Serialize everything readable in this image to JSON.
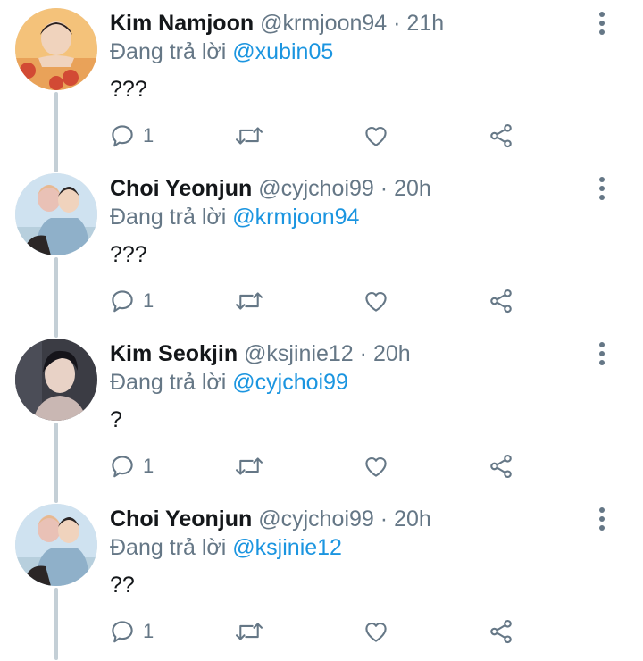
{
  "reply_prefix": "Đang trả lời",
  "tweets": [
    {
      "name": "Kim Namjoon",
      "handle": "@krmjoon94",
      "separator": "·",
      "time": "21h",
      "reply_to": "@xubin05",
      "text": "???",
      "reply_count": "1",
      "avatar_palette": [
        "#e9a259",
        "#d24a34",
        "#f4c27a",
        "#2a2120"
      ]
    },
    {
      "name": "Choi Yeonjun",
      "handle": "@cyjchoi99",
      "separator": "·",
      "time": "20h",
      "reply_to": "@krmjoon94",
      "text": "???",
      "reply_count": "1",
      "avatar_palette": [
        "#cfe2f0",
        "#e9c1b6",
        "#8fb0c9",
        "#2b2626"
      ]
    },
    {
      "name": "Kim Seokjin",
      "handle": "@ksjinie12",
      "separator": "·",
      "time": "20h",
      "reply_to": "@cyjchoi99",
      "text": "?",
      "reply_count": "1",
      "avatar_palette": [
        "#3b3c44",
        "#e8d2c6",
        "#c9b7b3",
        "#15141a"
      ]
    },
    {
      "name": "Choi Yeonjun",
      "handle": "@cyjchoi99",
      "separator": "·",
      "time": "20h",
      "reply_to": "@ksjinie12",
      "text": "??",
      "reply_count": "1",
      "avatar_palette": [
        "#cfe2f0",
        "#e9c1b6",
        "#8fb0c9",
        "#2b2626"
      ]
    }
  ],
  "colors": {
    "text": "#14171a",
    "secondary": "#657786",
    "link": "#1b95e0",
    "thread_line": "#c4cfd6"
  },
  "icons": {
    "reply": "reply-icon",
    "retweet": "retweet-icon",
    "like": "like-icon",
    "share": "share-icon",
    "more": "more-vertical-icon"
  }
}
